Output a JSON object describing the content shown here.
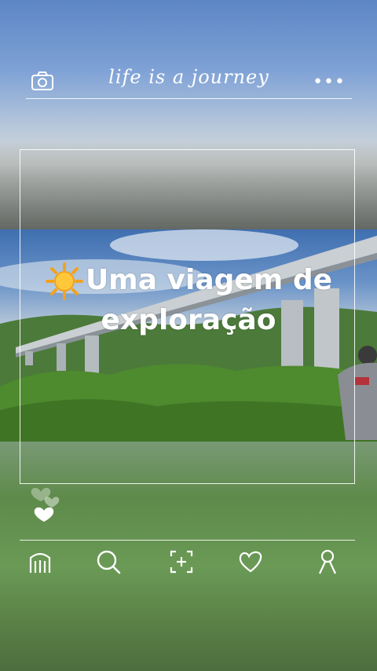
{
  "header": {
    "title": "life is a journey",
    "more_label": "•••"
  },
  "post": {
    "caption_line1": "Uma viagem de",
    "caption_line2": "exploração"
  },
  "nav": {
    "items": [
      "home-icon",
      "search-icon",
      "add-post-icon",
      "heart-icon",
      "profile-icon"
    ]
  }
}
